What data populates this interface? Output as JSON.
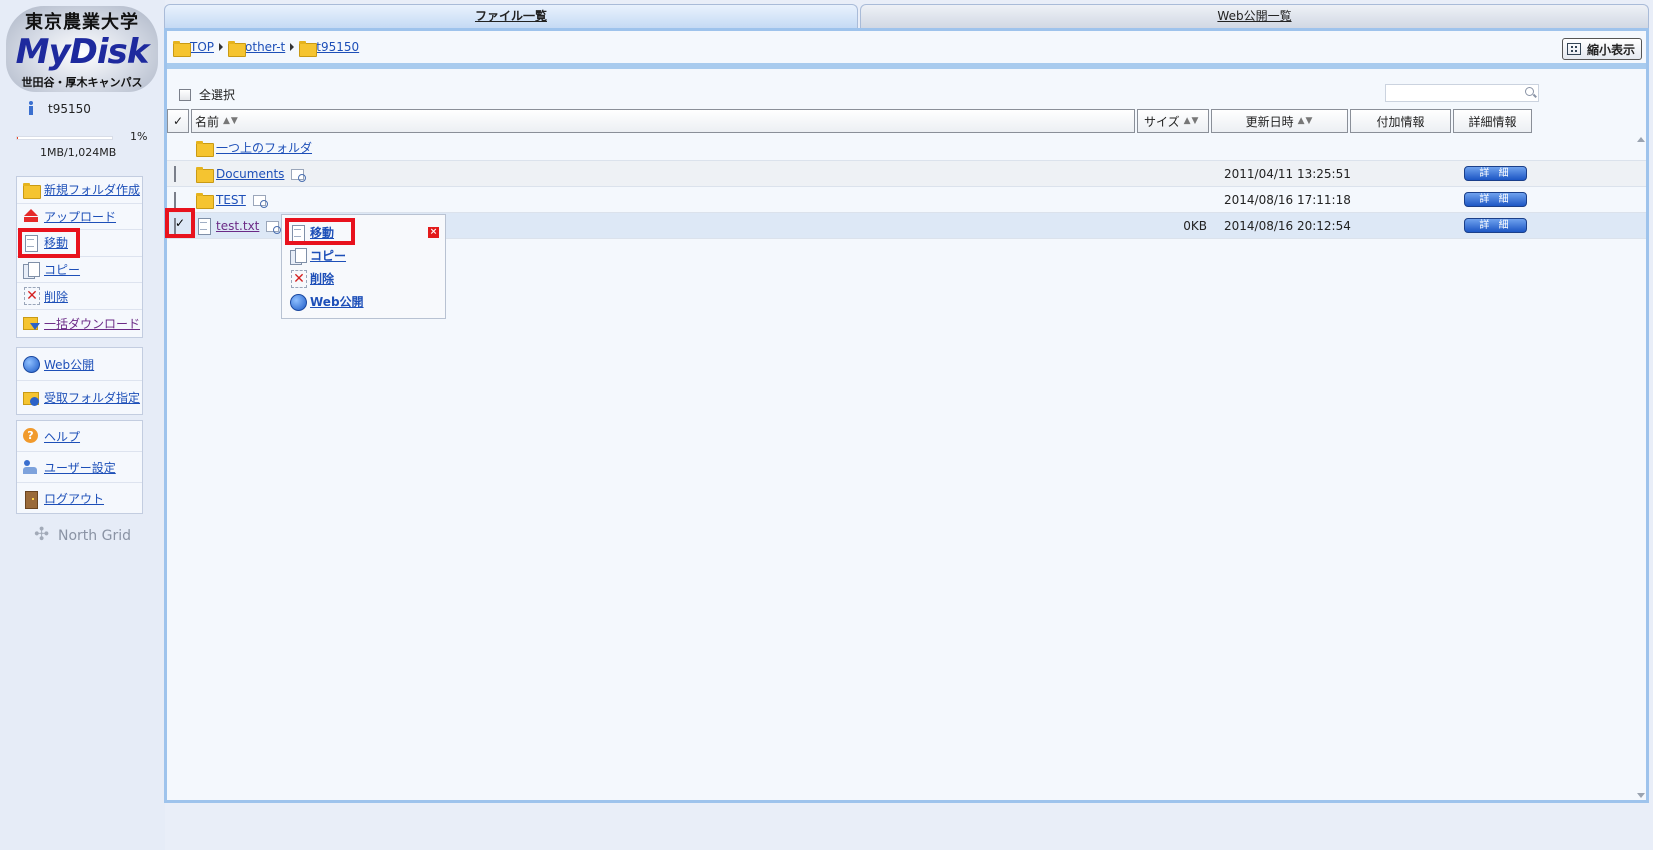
{
  "logo": {
    "university": "東京農業大学",
    "product": "MyDisk",
    "campus": "世田谷・厚木キャンパス"
  },
  "user": {
    "name": "t95150"
  },
  "quota": {
    "percent_label": "1%",
    "percent": 1,
    "used": "1MB/1,024MB"
  },
  "sidebar": {
    "file_actions": [
      {
        "label": "新規フォルダ作成",
        "icon": "new-folder-icon"
      },
      {
        "label": "アップロード",
        "icon": "upload-icon"
      },
      {
        "label": "移動",
        "icon": "move-icon"
      },
      {
        "label": "コピー",
        "icon": "copy-icon"
      },
      {
        "label": "削除",
        "icon": "delete-icon"
      },
      {
        "label": "一括ダウンロード",
        "icon": "bulk-download-icon"
      }
    ],
    "web_actions": [
      {
        "label": "Web公開",
        "icon": "globe-icon"
      },
      {
        "label": "受取フォルダ指定",
        "icon": "receive-folder-icon"
      }
    ],
    "account_actions": [
      {
        "label": "ヘルプ",
        "icon": "help-icon"
      },
      {
        "label": "ユーザー設定",
        "icon": "user-settings-icon"
      },
      {
        "label": "ログアウト",
        "icon": "logout-icon"
      }
    ],
    "footer": "North Grid"
  },
  "tabs": {
    "files": "ファイル一覧",
    "web": "Web公開一覧"
  },
  "breadcrumb": [
    "TOP",
    "other-t",
    "t95150"
  ],
  "toolbar": {
    "shrink_label": "縮小表示"
  },
  "list": {
    "select_all": "全選択",
    "search_placeholder": "",
    "headers": {
      "name": "名前",
      "size": "サイズ",
      "updated": "更新日時",
      "extra": "付加情報",
      "details": "詳細情報",
      "sort": "▲▼"
    },
    "up_folder": "一つ上のフォルダ",
    "rows": [
      {
        "name": "Documents",
        "size": "",
        "updated": "2011/04/11 13:25:51",
        "details": "詳細"
      },
      {
        "name": "TEST",
        "size": "",
        "updated": "2014/08/16 17:11:18",
        "details": "詳細"
      },
      {
        "name": "test.txt",
        "size": "0KB",
        "updated": "2014/08/16 20:12:54",
        "details": "詳細"
      }
    ]
  },
  "context_menu": {
    "items": [
      {
        "label": "移動",
        "icon": "move-icon"
      },
      {
        "label": "コピー",
        "icon": "copy-icon"
      },
      {
        "label": "削除",
        "icon": "delete-icon"
      },
      {
        "label": "Web公開",
        "icon": "globe-icon"
      }
    ],
    "close": "×"
  },
  "colors": {
    "highlight": "#e8121d",
    "accent": "#1c56c4",
    "link": "#1d4fb8"
  }
}
